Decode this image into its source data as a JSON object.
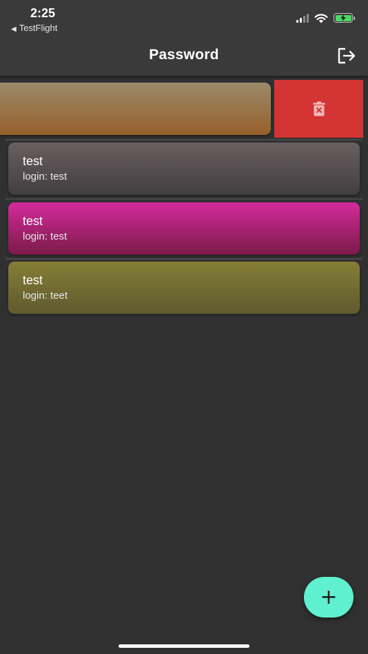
{
  "status_bar": {
    "time": "2:25",
    "back_app": "TestFlight",
    "back_caret": "◀"
  },
  "app_bar": {
    "title": "Password",
    "action_icon": "logout-icon"
  },
  "entries": [
    {
      "title": "",
      "subtitle": "",
      "gradient": [
        "#9c8a6a",
        "#97602a"
      ],
      "swiped": true
    },
    {
      "title": "test",
      "subtitle": "login: test",
      "gradient": [
        "#6a5e60",
        "#423e40"
      ]
    },
    {
      "title": "test",
      "subtitle": "login: test",
      "gradient": [
        "#d42a9c",
        "#7a1a48"
      ]
    },
    {
      "title": "test",
      "subtitle": "login: teet",
      "gradient": [
        "#857e36",
        "#5e5a2e"
      ]
    }
  ],
  "swipe_action": {
    "icon": "trash-icon",
    "color": "#d43434"
  },
  "fab": {
    "label": "+",
    "color": "#5ff0cf"
  },
  "colors": {
    "background": "#303030",
    "app_bar": "#3a3a3a",
    "battery": "#4cd964"
  }
}
